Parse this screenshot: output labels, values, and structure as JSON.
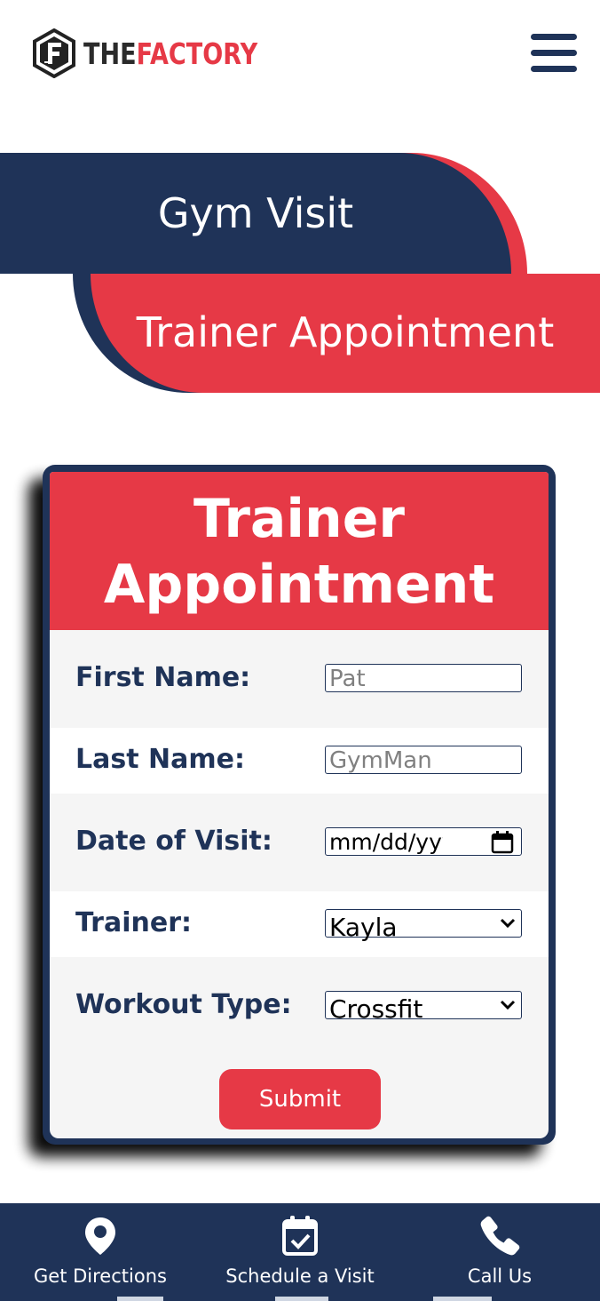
{
  "header": {
    "logo": {
      "text_the": "THE",
      "text_factory": "FACTORY",
      "icon": "factory-f-logo-icon"
    },
    "menu_icon": "hamburger-menu-icon"
  },
  "tabs": {
    "gym_visit": "Gym Visit",
    "trainer_appointment": "Trainer Appointment"
  },
  "form": {
    "title_line1": "Trainer",
    "title_line2": "Appointment",
    "fields": {
      "first_name": {
        "label": "First Name:",
        "placeholder": "Pat"
      },
      "last_name": {
        "label": "Last Name:",
        "placeholder": "GymMan"
      },
      "date": {
        "label": "Date of Visit:",
        "placeholder": "mm/dd/yyyy",
        "icon": "calendar-icon"
      },
      "trainer": {
        "label": "Trainer:",
        "selected": "Kayla"
      },
      "workout": {
        "label": "Workout Type:",
        "selected": "Crossfit"
      }
    },
    "submit_label": "Submit"
  },
  "bottom_nav": {
    "directions": {
      "label": "Get Directions",
      "icon": "map-pin-icon"
    },
    "schedule": {
      "label": "Schedule a Visit",
      "icon": "calendar-check-icon"
    },
    "call": {
      "label": "Call Us",
      "icon": "phone-icon"
    }
  },
  "colors": {
    "navy": "#1f3358",
    "red": "#e63946",
    "light_gray": "#f5f5f5",
    "white": "#ffffff"
  }
}
